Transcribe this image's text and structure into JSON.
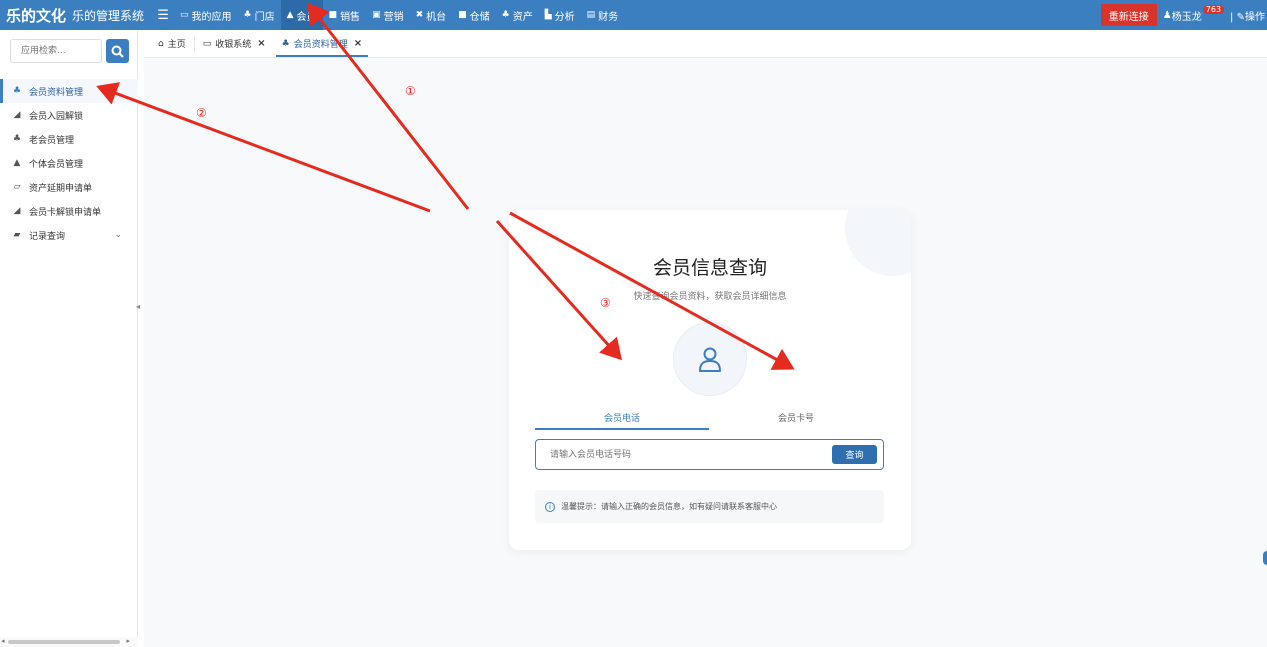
{
  "header": {
    "brand": "乐的文化",
    "system_name": "乐的管理系统",
    "nav": [
      {
        "label": "我的应用",
        "icon": "monitor-icon"
      },
      {
        "label": "门店",
        "icon": "sitemap-icon"
      },
      {
        "label": "会员",
        "icon": "lock-icon",
        "active": true
      },
      {
        "label": "销售",
        "icon": "briefcase-icon"
      },
      {
        "label": "营销",
        "icon": "gift-icon"
      },
      {
        "label": "机台",
        "icon": "machine-icon"
      },
      {
        "label": "仓储",
        "icon": "box-icon"
      },
      {
        "label": "资产",
        "icon": "users-icon"
      },
      {
        "label": "分析",
        "icon": "chart-icon"
      },
      {
        "label": "财务",
        "icon": "ledger-icon"
      }
    ],
    "reconnect_label": "重新连接",
    "user_name": "杨玉龙",
    "user_badge": "763",
    "ops_label": "操作"
  },
  "sidebar": {
    "search_placeholder": "应用检索...",
    "items": [
      {
        "label": "会员资料管理",
        "icon": "users-icon",
        "active": true
      },
      {
        "label": "会员入园解锁",
        "icon": "unlock-icon"
      },
      {
        "label": "老会员管理",
        "icon": "sitemap-icon"
      },
      {
        "label": "个体会员管理",
        "icon": "lock-icon"
      },
      {
        "label": "资产延期申请单",
        "icon": "folder-open-icon"
      },
      {
        "label": "会员卡解锁申请单",
        "icon": "unlock-icon"
      },
      {
        "label": "记录查询",
        "icon": "book-icon",
        "has_children": true
      }
    ]
  },
  "tabs": [
    {
      "label": "主页",
      "icon": "home-icon",
      "closable": false
    },
    {
      "label": "收银系统",
      "icon": "monitor-icon",
      "closable": true
    },
    {
      "label": "会员资料管理",
      "icon": "users-icon",
      "closable": true,
      "active": true
    }
  ],
  "card": {
    "title": "会员信息查询",
    "subtitle": "快速查询会员资料，获取会员详细信息",
    "query_tabs": [
      "会员电话",
      "会员卡号"
    ],
    "active_query_tab": 0,
    "input_placeholder": "请输入会员电话号码",
    "query_button": "查询",
    "tip": "温馨提示：请输入正确的会员信息，如有疑问请联系客服中心"
  },
  "annotations": {
    "color": "#e52b1f",
    "labels": [
      "①",
      "②",
      "③"
    ]
  },
  "colors": {
    "primary": "#3c7fc0",
    "danger": "#d9342b",
    "annotation": "#e52b1f"
  }
}
